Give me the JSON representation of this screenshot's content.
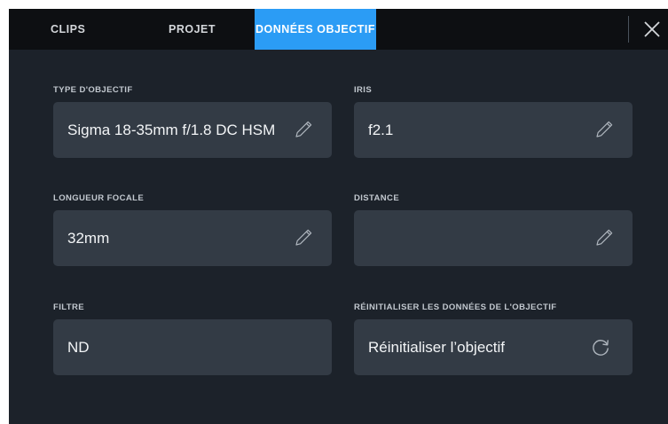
{
  "tabs": {
    "clips": "CLIPS",
    "projet": "PROJET",
    "donnees": "DONNÉES OBJECTIF"
  },
  "lens_type": {
    "label": "TYPE D'OBJECTIF",
    "value": "Sigma 18-35mm f/1.8 DC HSM"
  },
  "iris": {
    "label": "IRIS",
    "value": "f2.1"
  },
  "focal_length": {
    "label": "LONGUEUR FOCALE",
    "value": "32mm"
  },
  "distance": {
    "label": "DISTANCE",
    "value": ""
  },
  "filter": {
    "label": "FILTRE",
    "value": "ND"
  },
  "reset": {
    "label": "RÉINITIALISER LES DONNÉES DE L'OBJECTIF",
    "button_label": "Réinitialiser l’objectif"
  },
  "icons": {
    "edit": "pencil-icon",
    "close": "close-icon",
    "reset": "refresh-icon"
  },
  "colors": {
    "accent": "#2b9cf5",
    "background": "#1c222a",
    "field": "#333b45",
    "topbar": "#0d0f12"
  }
}
